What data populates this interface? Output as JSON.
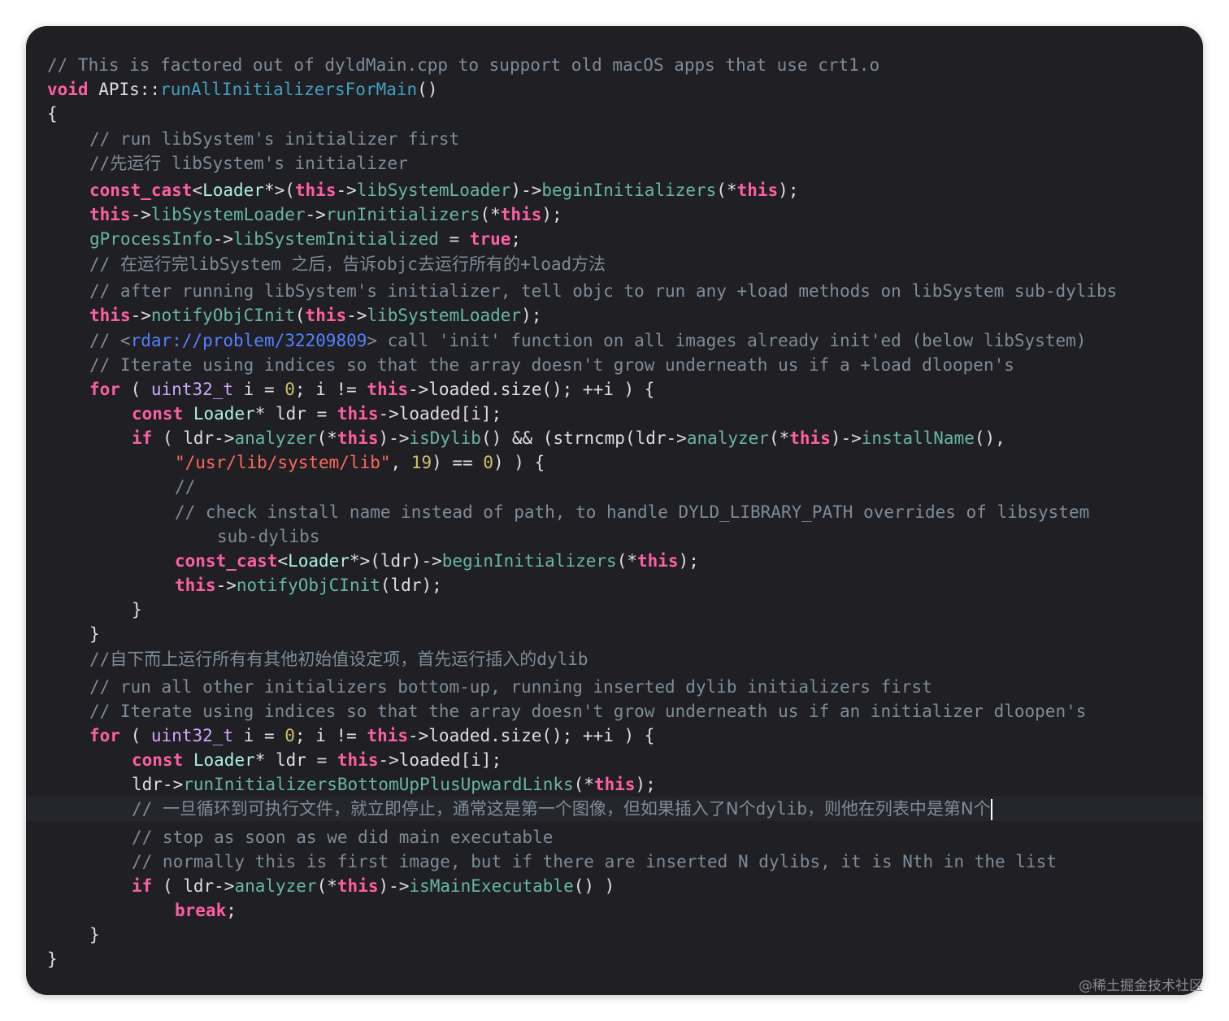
{
  "editor": {
    "lines": [
      [
        {
          "t": "// This is factored out of dyldMain.cpp to support old macOS apps that use crt1.o",
          "c": "comment"
        }
      ],
      [
        {
          "t": "void",
          "c": "kw"
        },
        {
          "t": " APIs::",
          "c": "plain"
        },
        {
          "t": "runAllInitializersForMain",
          "c": "fn2"
        },
        {
          "t": "()",
          "c": "plain"
        }
      ],
      [
        {
          "t": "{",
          "c": "plain"
        }
      ],
      [
        {
          "t": "    // run libSystem's initializer first",
          "c": "comment"
        }
      ],
      [
        {
          "t": "    //",
          "c": "comment"
        },
        {
          "t": "先运行",
          "c": "comment cjk"
        },
        {
          "t": " libSystem's initializer",
          "c": "comment"
        }
      ],
      [
        {
          "t": "    ",
          "c": "plain"
        },
        {
          "t": "const_cast",
          "c": "kw"
        },
        {
          "t": "<",
          "c": "plain"
        },
        {
          "t": "Loader",
          "c": "type2"
        },
        {
          "t": "*>(",
          "c": "plain"
        },
        {
          "t": "this",
          "c": "kw"
        },
        {
          "t": "->",
          "c": "plain"
        },
        {
          "t": "libSystemLoader",
          "c": "fn"
        },
        {
          "t": ")->",
          "c": "plain"
        },
        {
          "t": "beginInitializers",
          "c": "fn"
        },
        {
          "t": "(*",
          "c": "plain"
        },
        {
          "t": "this",
          "c": "kw"
        },
        {
          "t": ");",
          "c": "plain"
        }
      ],
      [
        {
          "t": "    ",
          "c": "plain"
        },
        {
          "t": "this",
          "c": "kw"
        },
        {
          "t": "->",
          "c": "plain"
        },
        {
          "t": "libSystemLoader",
          "c": "fn"
        },
        {
          "t": "->",
          "c": "plain"
        },
        {
          "t": "runInitializers",
          "c": "fn"
        },
        {
          "t": "(*",
          "c": "plain"
        },
        {
          "t": "this",
          "c": "kw"
        },
        {
          "t": ");",
          "c": "plain"
        }
      ],
      [
        {
          "t": "    ",
          "c": "plain"
        },
        {
          "t": "gProcessInfo",
          "c": "fn"
        },
        {
          "t": "->",
          "c": "plain"
        },
        {
          "t": "libSystemInitialized",
          "c": "fn"
        },
        {
          "t": " = ",
          "c": "plain"
        },
        {
          "t": "true",
          "c": "kw"
        },
        {
          "t": ";",
          "c": "plain"
        }
      ],
      [
        {
          "t": "    // ",
          "c": "comment"
        },
        {
          "t": "在运行完",
          "c": "comment cjk"
        },
        {
          "t": "libSystem ",
          "c": "comment"
        },
        {
          "t": "之后，告诉",
          "c": "comment cjk"
        },
        {
          "t": "objc",
          "c": "comment"
        },
        {
          "t": "去运行所有的",
          "c": "comment cjk"
        },
        {
          "t": "+load",
          "c": "comment"
        },
        {
          "t": "方法",
          "c": "comment cjk"
        }
      ],
      [
        {
          "t": "    // after running libSystem's initializer, tell objc to run any +load methods on libSystem sub-dylibs",
          "c": "comment"
        }
      ],
      [
        {
          "t": "    ",
          "c": "plain"
        },
        {
          "t": "this",
          "c": "kw"
        },
        {
          "t": "->",
          "c": "plain"
        },
        {
          "t": "notifyObjCInit",
          "c": "fn"
        },
        {
          "t": "(",
          "c": "plain"
        },
        {
          "t": "this",
          "c": "kw"
        },
        {
          "t": "->",
          "c": "plain"
        },
        {
          "t": "libSystemLoader",
          "c": "fn"
        },
        {
          "t": ");",
          "c": "plain"
        }
      ],
      [
        {
          "t": "    // <",
          "c": "comment"
        },
        {
          "t": "rdar://problem/32209809",
          "c": "link"
        },
        {
          "t": "> call 'init' function on all images already init'ed (below libSystem)",
          "c": "comment"
        }
      ],
      [
        {
          "t": "    // Iterate using indices so that the array doesn't grow underneath us if a +load dloopen's",
          "c": "comment"
        }
      ],
      [
        {
          "t": "    ",
          "c": "plain"
        },
        {
          "t": "for",
          "c": "kw"
        },
        {
          "t": " ( ",
          "c": "plain"
        },
        {
          "t": "uint32_t",
          "c": "type"
        },
        {
          "t": " i = ",
          "c": "plain"
        },
        {
          "t": "0",
          "c": "num"
        },
        {
          "t": "; i != ",
          "c": "plain"
        },
        {
          "t": "this",
          "c": "kw"
        },
        {
          "t": "->loaded.size(); ++i ) {",
          "c": "plain"
        }
      ],
      [
        {
          "t": "        ",
          "c": "plain"
        },
        {
          "t": "const",
          "c": "kw"
        },
        {
          "t": " ",
          "c": "plain"
        },
        {
          "t": "Loader",
          "c": "type2"
        },
        {
          "t": "* ldr = ",
          "c": "plain"
        },
        {
          "t": "this",
          "c": "kw"
        },
        {
          "t": "->loaded[i];",
          "c": "plain"
        }
      ],
      [
        {
          "t": "        ",
          "c": "plain"
        },
        {
          "t": "if",
          "c": "kw"
        },
        {
          "t": " ( ldr->",
          "c": "plain"
        },
        {
          "t": "analyzer",
          "c": "fn"
        },
        {
          "t": "(*",
          "c": "plain"
        },
        {
          "t": "this",
          "c": "kw"
        },
        {
          "t": ")->",
          "c": "plain"
        },
        {
          "t": "isDylib",
          "c": "fn"
        },
        {
          "t": "() && (strncmp(ldr->",
          "c": "plain"
        },
        {
          "t": "analyzer",
          "c": "fn"
        },
        {
          "t": "(*",
          "c": "plain"
        },
        {
          "t": "this",
          "c": "kw"
        },
        {
          "t": ")->",
          "c": "plain"
        },
        {
          "t": "installName",
          "c": "fn"
        },
        {
          "t": "(),",
          "c": "plain"
        }
      ],
      [
        {
          "t": "            ",
          "c": "plain"
        },
        {
          "t": "\"/usr/lib/system/lib\"",
          "c": "str"
        },
        {
          "t": ", ",
          "c": "plain"
        },
        {
          "t": "19",
          "c": "num"
        },
        {
          "t": ") == ",
          "c": "plain"
        },
        {
          "t": "0",
          "c": "num"
        },
        {
          "t": ") ) {",
          "c": "plain"
        }
      ],
      [
        {
          "t": "            //",
          "c": "comment"
        }
      ],
      [
        {
          "t": "            // check install name instead of path, to handle DYLD_LIBRARY_PATH overrides of libsystem",
          "c": "comment"
        }
      ],
      [
        {
          "t": "                sub-dylibs",
          "c": "comment"
        }
      ],
      [
        {
          "t": "            ",
          "c": "plain"
        },
        {
          "t": "const_cast",
          "c": "kw"
        },
        {
          "t": "<",
          "c": "plain"
        },
        {
          "t": "Loader",
          "c": "type2"
        },
        {
          "t": "*>(ldr)->",
          "c": "plain"
        },
        {
          "t": "beginInitializers",
          "c": "fn"
        },
        {
          "t": "(*",
          "c": "plain"
        },
        {
          "t": "this",
          "c": "kw"
        },
        {
          "t": ");",
          "c": "plain"
        }
      ],
      [
        {
          "t": "            ",
          "c": "plain"
        },
        {
          "t": "this",
          "c": "kw"
        },
        {
          "t": "->",
          "c": "plain"
        },
        {
          "t": "notifyObjCInit",
          "c": "fn"
        },
        {
          "t": "(ldr);",
          "c": "plain"
        }
      ],
      [
        {
          "t": "        }",
          "c": "plain"
        }
      ],
      [
        {
          "t": "    }",
          "c": "plain"
        }
      ],
      [
        {
          "t": "    //",
          "c": "comment"
        },
        {
          "t": "自下而上运行所有有其他初始值设定项，首先运行插入的",
          "c": "comment cjk"
        },
        {
          "t": "dylib",
          "c": "comment"
        }
      ],
      [
        {
          "t": "    // run all other initializers bottom-up, running inserted dylib initializers first",
          "c": "comment"
        }
      ],
      [
        {
          "t": "    // Iterate using indices so that the array doesn't grow underneath us if an initializer dloopen's",
          "c": "comment"
        }
      ],
      [
        {
          "t": "    ",
          "c": "plain"
        },
        {
          "t": "for",
          "c": "kw"
        },
        {
          "t": " ( ",
          "c": "plain"
        },
        {
          "t": "uint32_t",
          "c": "type"
        },
        {
          "t": " i = ",
          "c": "plain"
        },
        {
          "t": "0",
          "c": "num"
        },
        {
          "t": "; i != ",
          "c": "plain"
        },
        {
          "t": "this",
          "c": "kw"
        },
        {
          "t": "->loaded.size(); ++i ) {",
          "c": "plain"
        }
      ],
      [
        {
          "t": "        ",
          "c": "plain"
        },
        {
          "t": "const",
          "c": "kw"
        },
        {
          "t": " ",
          "c": "plain"
        },
        {
          "t": "Loader",
          "c": "type2"
        },
        {
          "t": "* ldr = ",
          "c": "plain"
        },
        {
          "t": "this",
          "c": "kw"
        },
        {
          "t": "->loaded[i];",
          "c": "plain"
        }
      ],
      [
        {
          "t": "        ldr->",
          "c": "plain"
        },
        {
          "t": "runInitializersBottomUpPlusUpwardLinks",
          "c": "fn"
        },
        {
          "t": "(*",
          "c": "plain"
        },
        {
          "t": "this",
          "c": "kw"
        },
        {
          "t": ");",
          "c": "plain"
        }
      ],
      [
        {
          "t": "        // ",
          "c": "comment"
        },
        {
          "t": "一旦循环到可执行文件，就立即停止，通常这是第一个图像，但如果插入了N个",
          "c": "comment cjk"
        },
        {
          "t": "dylib",
          "c": "comment"
        },
        {
          "t": "，则他在列表中是第N个",
          "c": "comment cjk"
        }
      ],
      [
        {
          "t": "        // stop as soon as we did main executable",
          "c": "comment"
        }
      ],
      [
        {
          "t": "        // normally this is first image, but if there are inserted N dylibs, it is Nth in the list",
          "c": "comment"
        }
      ],
      [
        {
          "t": "        ",
          "c": "plain"
        },
        {
          "t": "if",
          "c": "kw"
        },
        {
          "t": " ( ldr->",
          "c": "plain"
        },
        {
          "t": "analyzer",
          "c": "fn"
        },
        {
          "t": "(*",
          "c": "plain"
        },
        {
          "t": "this",
          "c": "kw"
        },
        {
          "t": ")->",
          "c": "plain"
        },
        {
          "t": "isMainExecutable",
          "c": "fn"
        },
        {
          "t": "() )",
          "c": "plain"
        }
      ],
      [
        {
          "t": "            ",
          "c": "plain"
        },
        {
          "t": "break",
          "c": "kw"
        },
        {
          "t": ";",
          "c": "plain"
        }
      ],
      [
        {
          "t": "    }",
          "c": "plain"
        }
      ],
      [
        {
          "t": "}",
          "c": "plain"
        }
      ]
    ],
    "highlighted_line": 30
  },
  "watermark": "@稀土掘金技术社区"
}
